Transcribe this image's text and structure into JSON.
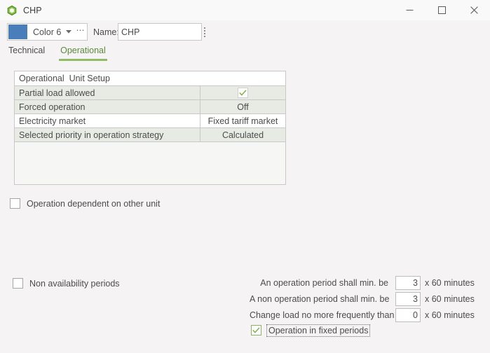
{
  "window": {
    "title": "CHP",
    "icon": "hexagon-ring-icon",
    "minimize_label": "Minimize",
    "maximize_label": "Maximize",
    "close_label": "Close"
  },
  "toolbar": {
    "color_value": "Color 6",
    "color_hex": "#4a7ebb",
    "dropdown_icon": "chevron-down-icon",
    "ellipsis_label": "⋯",
    "name_label": "Name:",
    "name_value": "CHP",
    "name_placeholder": "Name"
  },
  "tabs": [
    {
      "label": "Technical",
      "active": false
    },
    {
      "label": "Operational",
      "active": true
    }
  ],
  "setup_table": {
    "header": "Operational  Unit Setup",
    "rows": [
      {
        "label": "Partial load allowed",
        "value": "",
        "control": "checkbox",
        "checked": true
      },
      {
        "label": "Forced operation",
        "value": "Off",
        "control": "text"
      },
      {
        "label": "Electricity market",
        "value": "Fixed tariff market",
        "control": "text"
      },
      {
        "label": "Selected priority in operation strategy",
        "value": "Calculated",
        "control": "text"
      }
    ]
  },
  "dependency_checkbox": {
    "label": "Operation dependent on other unit",
    "checked": false
  },
  "non_availability_checkbox": {
    "label": "Non availability periods",
    "checked": false
  },
  "period_form": {
    "rows": [
      {
        "label": "An operation period shall min. be",
        "value": "3",
        "suffix": "x 60 minutes"
      },
      {
        "label": "A non operation period shall min. be",
        "value": "3",
        "suffix": "x 60 minutes"
      },
      {
        "label": "Change load no more frequently than",
        "value": "0",
        "suffix": "x 60 minutes"
      }
    ],
    "fixed_periods": {
      "label": "Operation in fixed periods",
      "checked": true,
      "focused": true
    }
  },
  "theme": {
    "accent": "#8fbc63",
    "accent_text": "#5a8a3c",
    "background": "#f5f3f3",
    "row_alt": "#e7ebe4",
    "border": "#c8c8c8",
    "text": "#4c4c4c"
  }
}
